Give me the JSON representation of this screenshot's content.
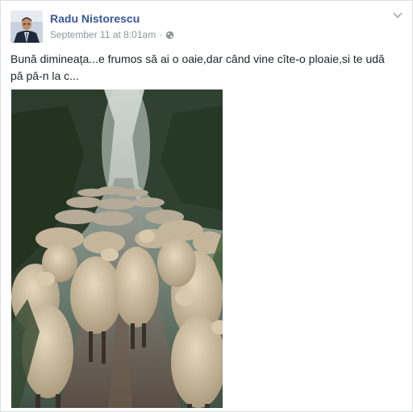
{
  "post": {
    "author": "Radu Nistorescu",
    "timestamp": "September 11 at 8:01am",
    "separator": "·",
    "privacy_icon": "globe-icon",
    "menu_icon": "chevron-down-icon",
    "line1": "Bună dimineața...e frumos să ai o oaie,dar când vine cîte-o ploaie,si te udă",
    "line2": "pă pâ-n la c..."
  },
  "colors": {
    "author_link": "#365899",
    "meta_text": "#90949c",
    "body_text": "#1d2129",
    "border": "#dddfe2"
  }
}
